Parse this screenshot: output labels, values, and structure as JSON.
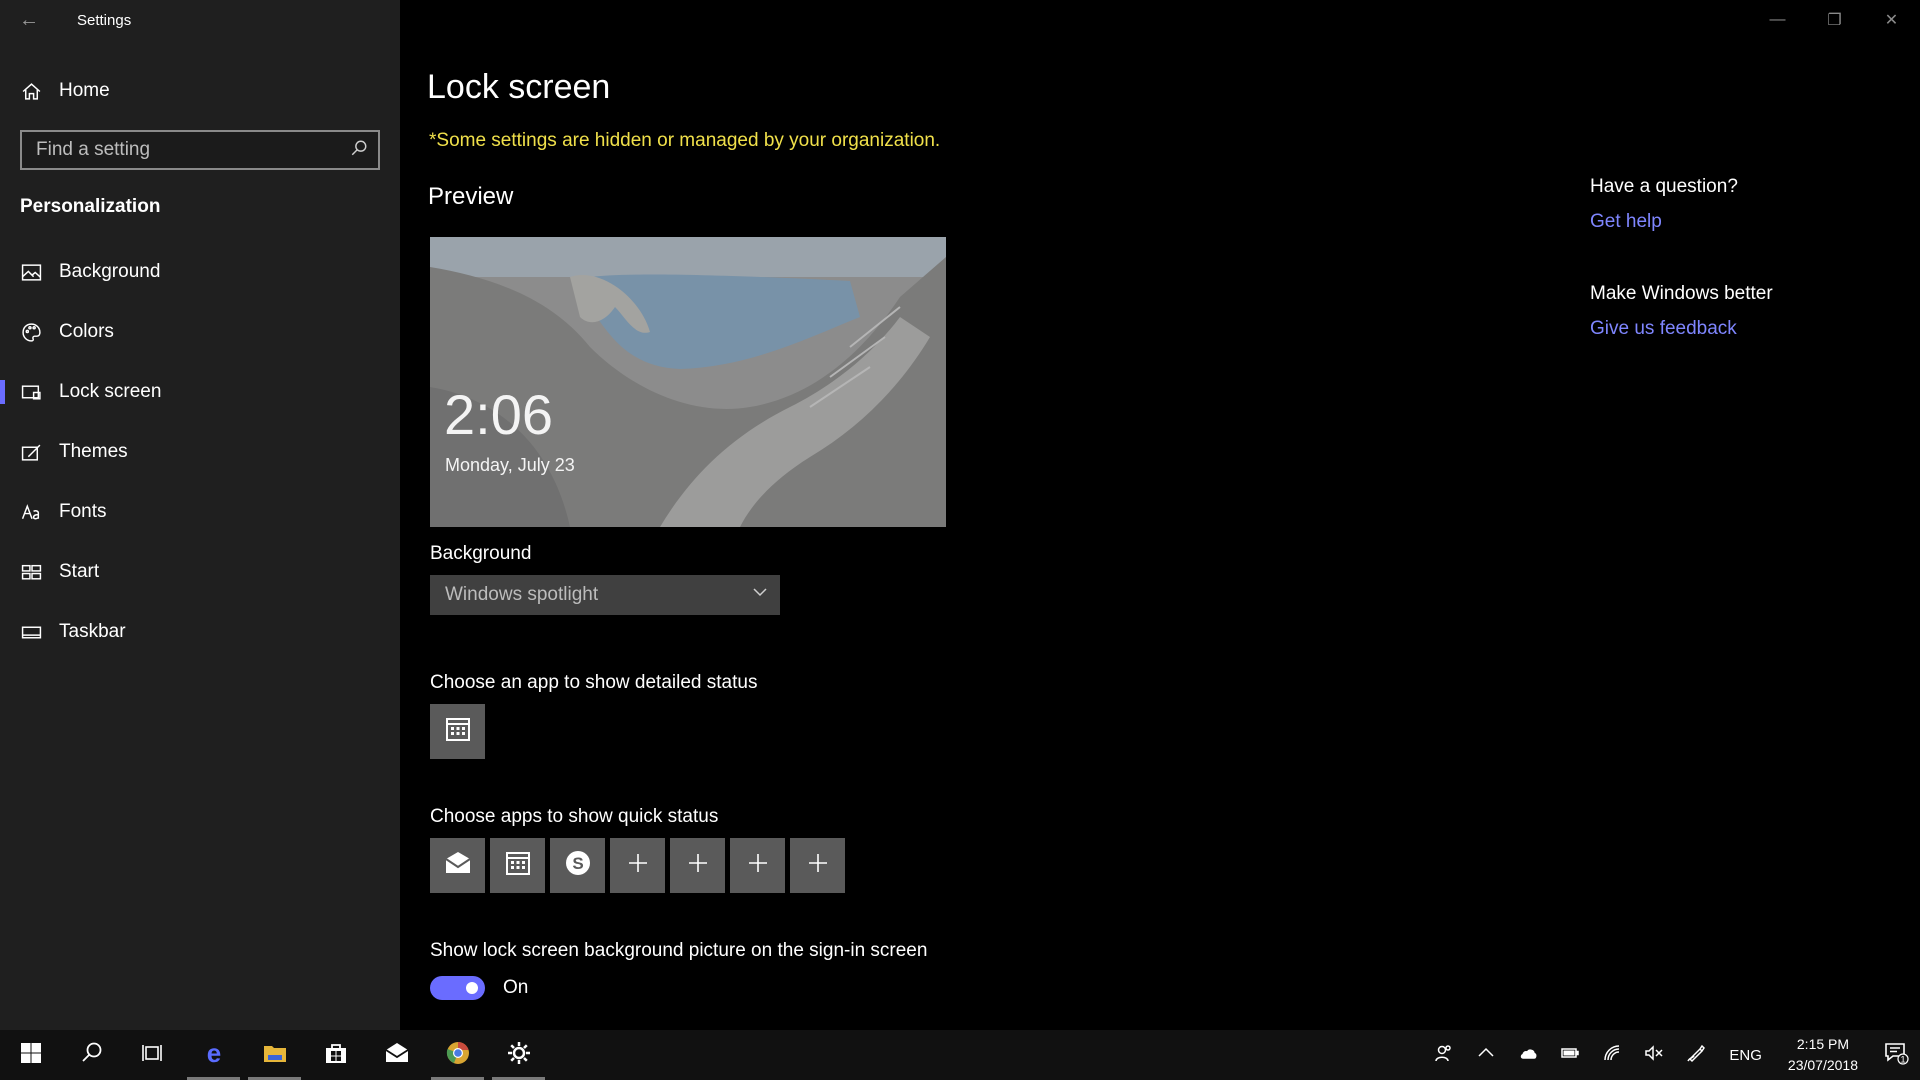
{
  "window": {
    "app_title": "Settings"
  },
  "sidebar": {
    "home_label": "Home",
    "search_placeholder": "Find a setting",
    "section_header": "Personalization",
    "items": [
      {
        "label": "Background",
        "icon": "picture-icon"
      },
      {
        "label": "Colors",
        "icon": "palette-icon"
      },
      {
        "label": "Lock screen",
        "icon": "lock-screen-icon",
        "active": true
      },
      {
        "label": "Themes",
        "icon": "themes-icon"
      },
      {
        "label": "Fonts",
        "icon": "fonts-icon"
      },
      {
        "label": "Start",
        "icon": "start-icon"
      },
      {
        "label": "Taskbar",
        "icon": "taskbar-icon"
      }
    ]
  },
  "main": {
    "page_title": "Lock screen",
    "org_notice": "*Some settings are hidden or managed by your organization.",
    "preview_title": "Preview",
    "preview_time": "2:06",
    "preview_date": "Monday, July 23",
    "background_label": "Background",
    "background_value": "Windows spotlight",
    "detailed_status_label": "Choose an app to show detailed status",
    "quick_status_label": "Choose apps to show quick status",
    "quick_status_apps": [
      "mail-icon",
      "calendar-icon",
      "skype-icon",
      "plus-icon",
      "plus-icon",
      "plus-icon",
      "plus-icon"
    ],
    "signin_label": "Show lock screen background picture on the sign-in screen",
    "signin_toggle_state": "On"
  },
  "help": {
    "question_title": "Have a question?",
    "get_help_link": "Get help",
    "better_title": "Make Windows better",
    "feedback_link": "Give us feedback"
  },
  "taskbar": {
    "language": "ENG",
    "time": "2:15 PM",
    "date": "23/07/2018",
    "notification_count": "1"
  },
  "colors": {
    "accent": "#6a6cff",
    "notice": "#f0e04a",
    "link": "#7f86ff"
  }
}
